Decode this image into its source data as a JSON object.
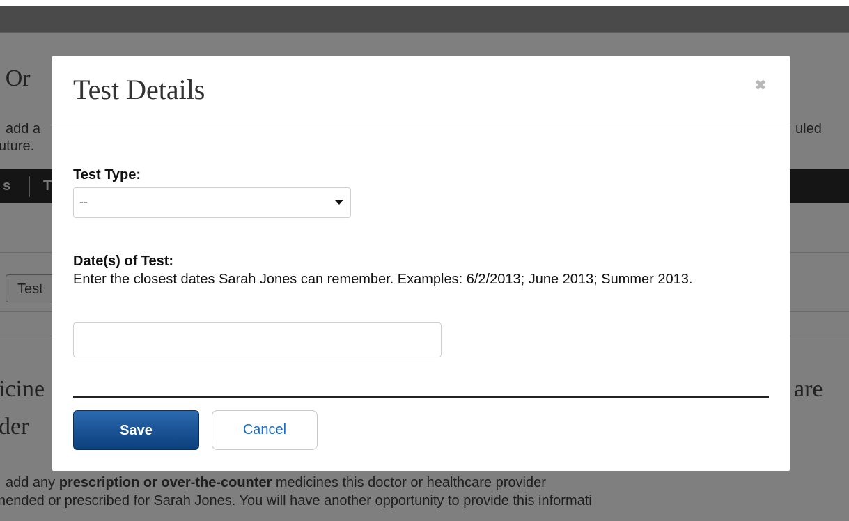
{
  "background": {
    "heading_fragment": "s Or",
    "intro_line1_left": "add a",
    "intro_line1_right": "uled",
    "intro_line2_left": "uture.",
    "table_col1": "s",
    "table_col2": "T",
    "test_button_label": "Test",
    "section_heading_line1_left": "icine",
    "section_heading_line1_right": "are",
    "section_heading_line2_left": "der",
    "footer_line1_pre": "add any ",
    "footer_line1_bold": "prescription or over-the-counter",
    "footer_line1_post": " medicines this doctor or healthcare provider",
    "footer_line2": "nended or prescribed for Sarah Jones. You will have another opportunity to provide this informati"
  },
  "modal": {
    "title": "Test Details",
    "close_glyph": "✖",
    "test_type_label": "Test Type:",
    "test_type_selected": "--",
    "dates_label": "Date(s) of Test:",
    "dates_help": "Enter the closest dates Sarah Jones can remember. Examples: 6/2/2013; June 2013; Summer 2013.",
    "dates_value": "",
    "save_label": "Save",
    "cancel_label": "Cancel"
  },
  "colors": {
    "overlay": "#7f7f7f",
    "primary_button": "#0c3f7d",
    "link": "#1a6cc4"
  }
}
